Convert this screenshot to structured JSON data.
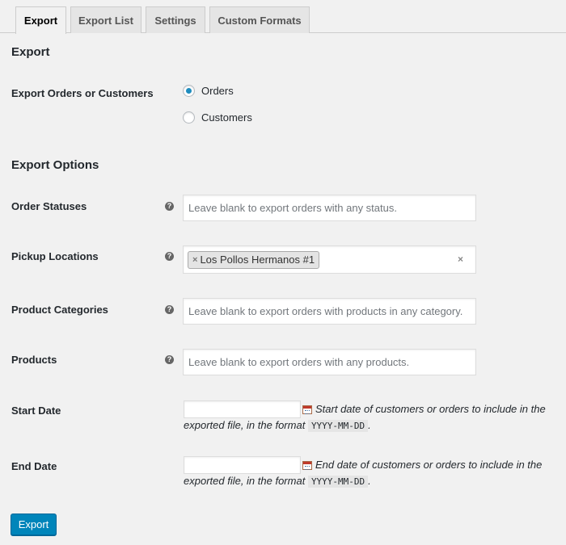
{
  "tabs": [
    {
      "label": "Export",
      "active": true
    },
    {
      "label": "Export List",
      "active": false
    },
    {
      "label": "Settings",
      "active": false
    },
    {
      "label": "Custom Formats",
      "active": false
    }
  ],
  "export_section": {
    "title": "Export",
    "type_label": "Export Orders or Customers",
    "options": [
      {
        "label": "Orders",
        "checked": true
      },
      {
        "label": "Customers",
        "checked": false
      }
    ]
  },
  "options_section": {
    "title": "Export Options",
    "order_statuses": {
      "label": "Order Statuses",
      "placeholder": "Leave blank to export orders with any status."
    },
    "pickup_locations": {
      "label": "Pickup Locations",
      "selected": "Los Pollos Hermanos #1",
      "chip_remove": "×",
      "clear": "×"
    },
    "product_categories": {
      "label": "Product Categories",
      "placeholder": "Leave blank to export orders with products in any category."
    },
    "products": {
      "label": "Products",
      "placeholder": "Leave blank to export orders with any products."
    },
    "start_date": {
      "label": "Start Date",
      "desc_line1": "Start date of customers or orders to include in the",
      "desc_line2": "exported file, in the format",
      "format": "YYYY-MM-DD",
      "period": "."
    },
    "end_date": {
      "label": "End Date",
      "desc_line1": "End date of customers or orders to include in the",
      "desc_line2": "exported file, in the format",
      "format": "YYYY-MM-DD",
      "period": "."
    }
  },
  "help_glyph": "?",
  "submit_label": "Export",
  "colors": {
    "primary_button": "#0085ba",
    "radio_checked": "#1e8cbe",
    "background": "#f1f1f1"
  }
}
